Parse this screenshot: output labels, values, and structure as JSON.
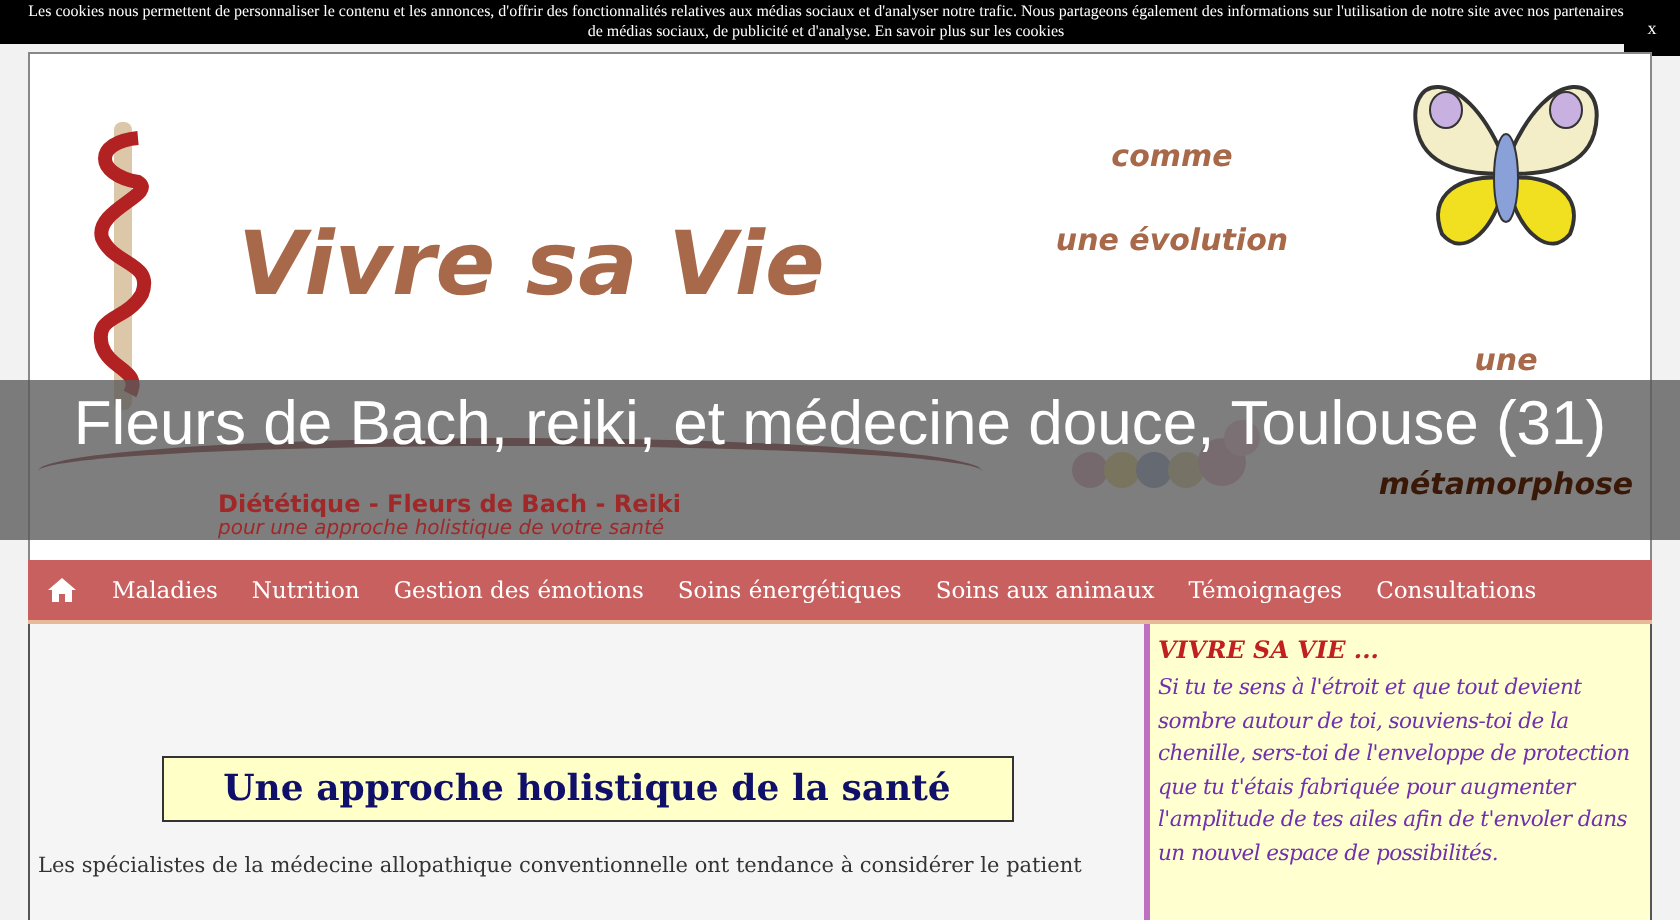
{
  "cookie_bar": {
    "text": "Les cookies nous permettent de personnaliser le contenu et les annonces, d'offrir des fonctionnalités relatives aux médias sociaux et d'analyser notre trafic. Nous partageons également des informations sur l'utilisation de notre site avec nos partenaires de médias sociaux, de publicité et d'analyse. En savoir plus sur les cookies",
    "close": "x"
  },
  "banner": {
    "title": "Vivre sa Vie",
    "tagline": [
      "comme",
      "une évolution",
      "une",
      "métamorphose"
    ],
    "subtitle": "Diététique - Fleurs de Bach - Reiki",
    "subtitle_note": "pour une approche holistique de votre santé"
  },
  "overlay_title": "Fleurs de Bach, reiki, et médecine douce, Toulouse (31)",
  "nav": [
    {
      "label": "Maladies"
    },
    {
      "label": "Nutrition"
    },
    {
      "label": "Gestion des émotions"
    },
    {
      "label": "Soins énergétiques"
    },
    {
      "label": "Soins aux animaux"
    },
    {
      "label": "Témoignages"
    },
    {
      "label": "Consultations"
    }
  ],
  "main": {
    "heading": "Une approche holistique de la santé",
    "paragraph": "Les spécialistes de la médecine allopathique conventionnelle ont tendance à considérer le patient"
  },
  "sidebar": {
    "title": "VIVRE SA VIE ...",
    "text": "Si tu te sens à l'étroit et que tout devient sombre autour de toi, souviens-toi de la chenille, sers-toi de l'enveloppe de protection que tu t'étais fabriquée pour augmenter l'amplitude de tes ailes afin de t'envoler dans un nouvel espace de possibilités."
  }
}
